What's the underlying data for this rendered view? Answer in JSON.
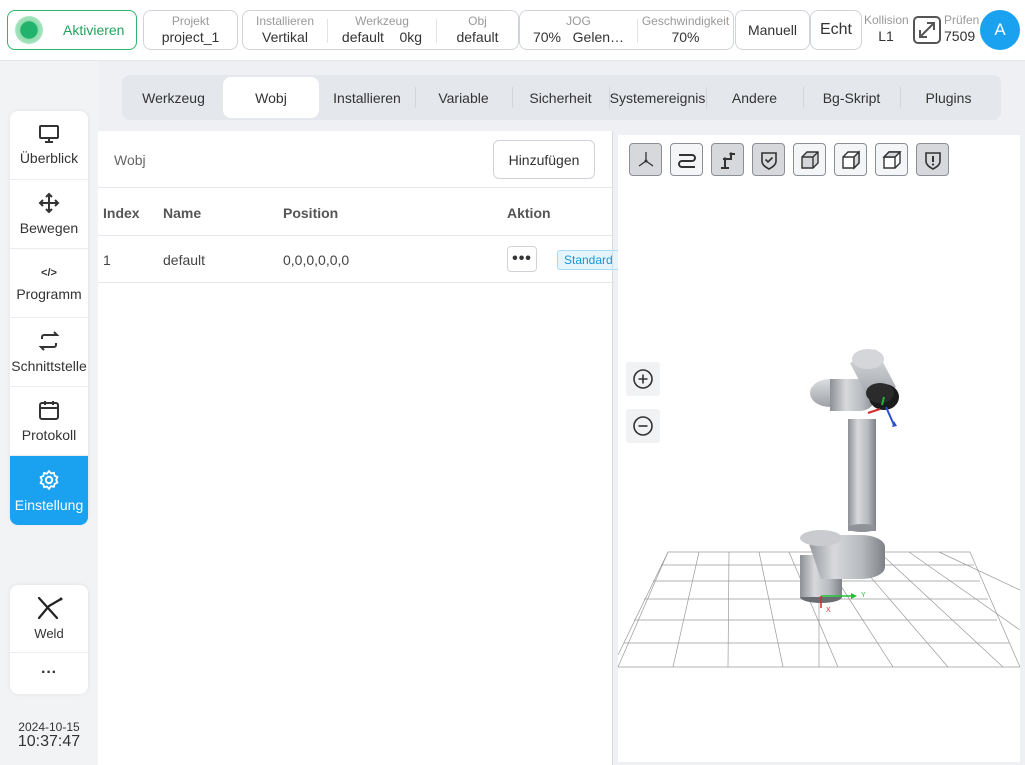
{
  "header": {
    "activate_label": "Aktivieren",
    "projekt": {
      "title": "Projekt",
      "value": "project_1"
    },
    "installieren": {
      "title": "Installieren",
      "value": "Vertikal"
    },
    "werkzeug": {
      "title": "Werkzeug",
      "value1": "default",
      "value2": "0kg"
    },
    "obj": {
      "title": "Obj",
      "value": "default"
    },
    "jog": {
      "title": "JOG",
      "value1": "70%",
      "value2": "Gelen…"
    },
    "geschwindigkeit": {
      "title": "Geschwindigkeit",
      "value": "70%"
    },
    "mode_button": "Manuell",
    "real_button": "Echt",
    "kollision": {
      "title": "Kollision",
      "value": "L1"
    },
    "pruefen": {
      "title": "Prüfen",
      "value": "7509"
    },
    "avatar": "A"
  },
  "nav": {
    "items": [
      {
        "label": "Überblick",
        "icon": "monitor-icon"
      },
      {
        "label": "Bewegen",
        "icon": "move-icon"
      },
      {
        "label": "Programm",
        "icon": "code-icon"
      },
      {
        "label": "Schnittstelle",
        "icon": "swap-icon"
      },
      {
        "label": "Protokoll",
        "icon": "calendar-icon"
      },
      {
        "label": "Einstellung",
        "icon": "gear-icon"
      }
    ],
    "active": "Einstellung",
    "weld_label": "Weld",
    "more_label": "···",
    "date": "2024-10-15",
    "time": "10:37:47"
  },
  "tabs": [
    "Werkzeug",
    "Wobj",
    "Installieren",
    "Variable",
    "Sicherheit",
    "Systemereignis",
    "Andere",
    "Bg-Skript",
    "Plugins"
  ],
  "active_tab": "Wobj",
  "panel": {
    "title": "Wobj",
    "add_button": "Hinzufügen",
    "columns": [
      "Index",
      "Name",
      "Position",
      "Aktion"
    ],
    "rows": [
      {
        "index": "1",
        "name": "default",
        "position": "0,0,0,0,0,0",
        "tag": "Standard"
      }
    ]
  },
  "colors": {
    "accent": "#1aa1f0",
    "active_green": "#21b36b"
  }
}
